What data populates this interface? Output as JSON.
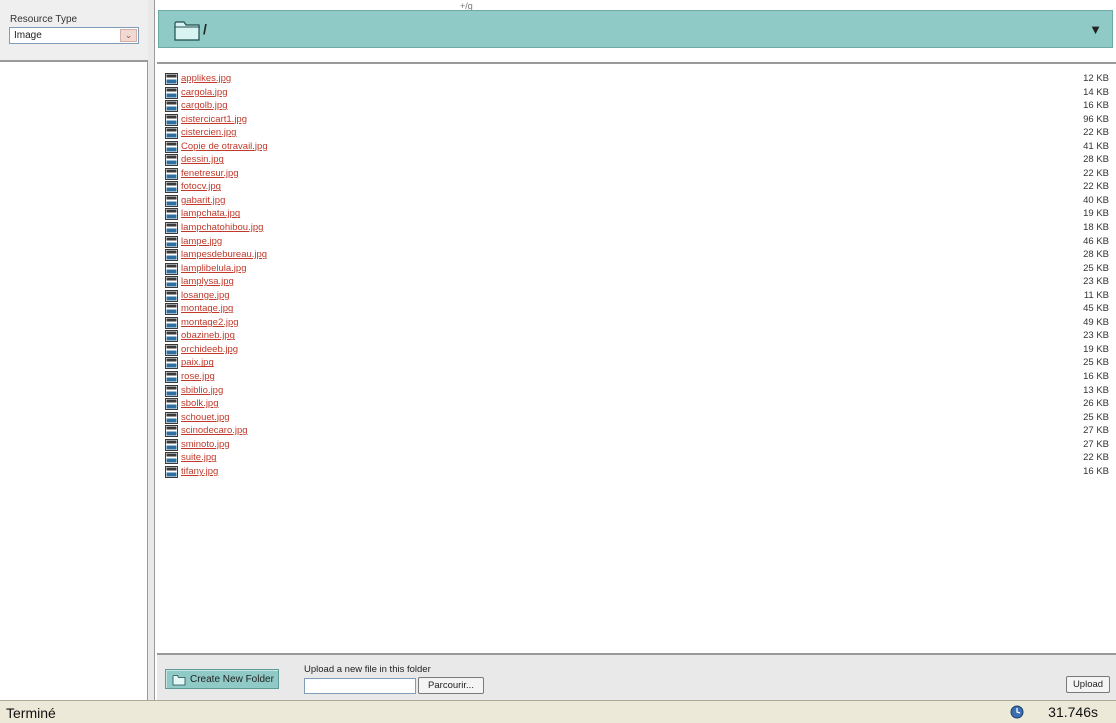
{
  "header_marker": "+/g",
  "left_panel": {
    "resource_type_label": "Resource Type",
    "resource_type_value": "Image"
  },
  "folder_bar": {
    "path": "/"
  },
  "files": [
    {
      "name": "applikes.jpg",
      "size": "12 KB"
    },
    {
      "name": "cargola.jpg",
      "size": "14 KB"
    },
    {
      "name": "cargolb.jpg",
      "size": "16 KB"
    },
    {
      "name": "cistercicart1.jpg",
      "size": "96 KB"
    },
    {
      "name": "cistercien.jpg",
      "size": "22 KB"
    },
    {
      "name": "Copie de otravail.jpg",
      "size": "41 KB"
    },
    {
      "name": "dessin.jpg",
      "size": "28 KB"
    },
    {
      "name": "fenetresur.jpg",
      "size": "22 KB"
    },
    {
      "name": "fotocv.jpg",
      "size": "22 KB"
    },
    {
      "name": "gabarit.jpg",
      "size": "40 KB"
    },
    {
      "name": "lampchata.jpg",
      "size": "19 KB"
    },
    {
      "name": "lampchatohibou.jpg",
      "size": "18 KB"
    },
    {
      "name": "lampe.jpg",
      "size": "46 KB"
    },
    {
      "name": "lampesdebureau.jpg",
      "size": "28 KB"
    },
    {
      "name": "lamplibelula.jpg",
      "size": "25 KB"
    },
    {
      "name": "lamplysa.jpg",
      "size": "23 KB"
    },
    {
      "name": "losange.jpg",
      "size": "11 KB"
    },
    {
      "name": "montage.jpg",
      "size": "45 KB"
    },
    {
      "name": "montage2.jpg",
      "size": "49 KB"
    },
    {
      "name": "obazineb.jpg",
      "size": "23 KB"
    },
    {
      "name": "orchideeb.jpg",
      "size": "19 KB"
    },
    {
      "name": "paix.jpg",
      "size": "25 KB"
    },
    {
      "name": "rose.jpg",
      "size": "16 KB"
    },
    {
      "name": "sbiblio.jpg",
      "size": "13 KB"
    },
    {
      "name": "sbolk.jpg",
      "size": "26 KB"
    },
    {
      "name": "schouet.jpg",
      "size": "25 KB"
    },
    {
      "name": "scinodecaro.jpg",
      "size": "27 KB"
    },
    {
      "name": "sminoto.jpg",
      "size": "27 KB"
    },
    {
      "name": "suite.jpg",
      "size": "22 KB"
    },
    {
      "name": "tifany.jpg",
      "size": "16 KB"
    }
  ],
  "file_icon_label": "JPG",
  "toolbar": {
    "create_folder_label": "Create New Folder",
    "upload_label": "Upload a new file in this folder",
    "browse_label": "Parcourir...",
    "upload_button_label": "Upload"
  },
  "status_bar": {
    "text": "Terminé",
    "timer": "31.746s"
  }
}
